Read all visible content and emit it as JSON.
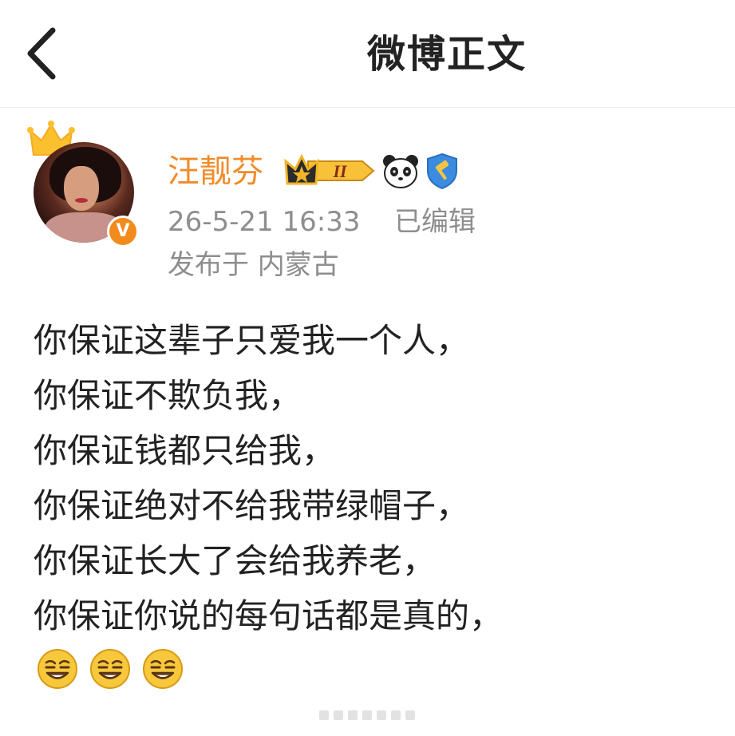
{
  "nav": {
    "title": "微博正文",
    "back_icon": "chevron-left-icon"
  },
  "post": {
    "author": {
      "name": "汪靓芬",
      "avatar_icon": "avatar",
      "verified_badge": "V",
      "verified_color": "#f38b1c",
      "crown_icon": "crown-icon",
      "badges": [
        "crown-level-badge",
        "panda-icon",
        "gavel-shield-icon"
      ],
      "level_label": "II",
      "name_color": "#f08b2a"
    },
    "timestamp": "26-5-21 16:33",
    "edited": "已编辑",
    "location": "发布于 内蒙古",
    "lines": [
      "你保证这辈子只爱我一个人，",
      "你保证不欺负我，",
      "你保证钱都只给我，",
      "你保证绝对不给我带绿帽子，",
      "你保证长大了会给我养老，",
      "你保证你说的每句话都是真的，"
    ],
    "emojis": [
      "smirk-emoji",
      "smirk-emoji",
      "smirk-emoji"
    ]
  }
}
